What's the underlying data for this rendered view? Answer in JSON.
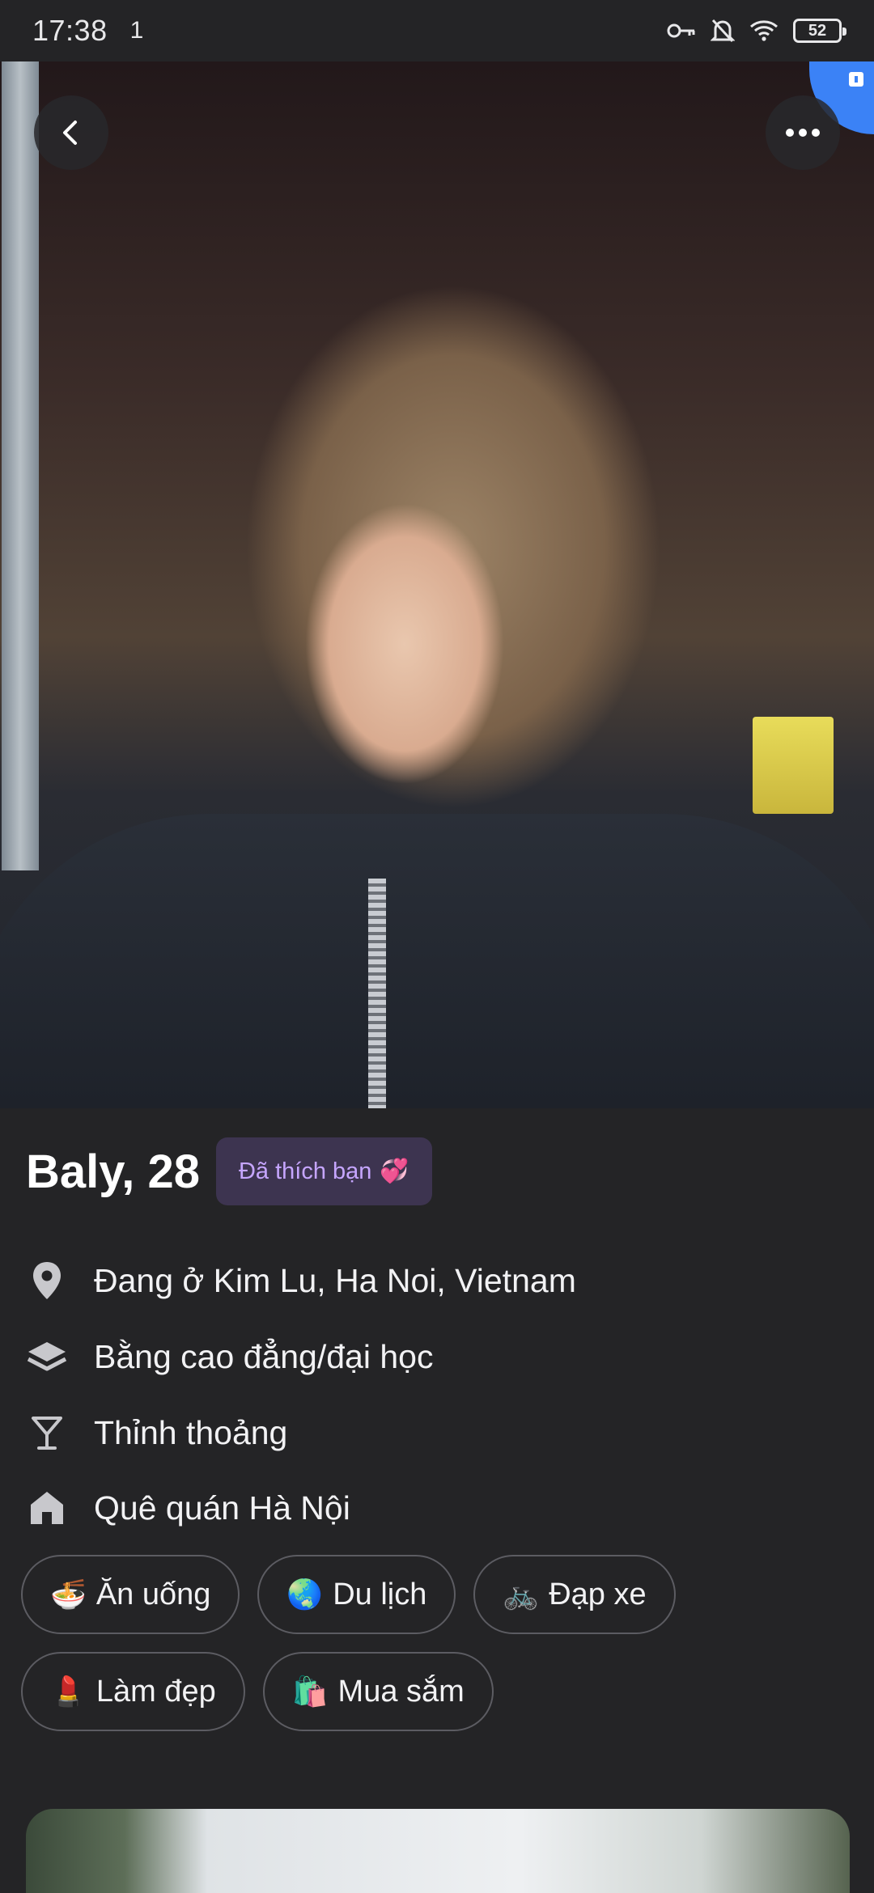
{
  "status_bar": {
    "time": "17:38",
    "notification": "1",
    "battery": "52"
  },
  "profile": {
    "name_age": "Baly, 28",
    "liked_badge": "Đã thích bạn",
    "liked_emoji": "💞",
    "info": [
      {
        "icon": "location-pin-icon",
        "text": "Đang ở Kim Lu, Ha Noi, Vietnam"
      },
      {
        "icon": "graduation-cap-icon",
        "text": "Bằng cao đẳng/đại học"
      },
      {
        "icon": "cocktail-glass-icon",
        "text": "Thỉnh thoảng"
      },
      {
        "icon": "home-icon",
        "text": "Quê quán Hà Nội"
      }
    ],
    "interests_row1": [
      {
        "emoji": "🍜",
        "label": "Ăn uống"
      },
      {
        "emoji": "🌏",
        "label": "Du lịch"
      },
      {
        "emoji": "🚲",
        "label": "Đạp xe"
      }
    ],
    "interests_row2": [
      {
        "emoji": "💄",
        "label": "Làm đẹp"
      },
      {
        "emoji": "🛍️",
        "label": "Mua sắm"
      }
    ]
  },
  "colors": {
    "background": "#242426",
    "badge_bg": "#3d3450",
    "badge_text": "#c6a6ff",
    "corner_badge": "#3b82f6"
  }
}
